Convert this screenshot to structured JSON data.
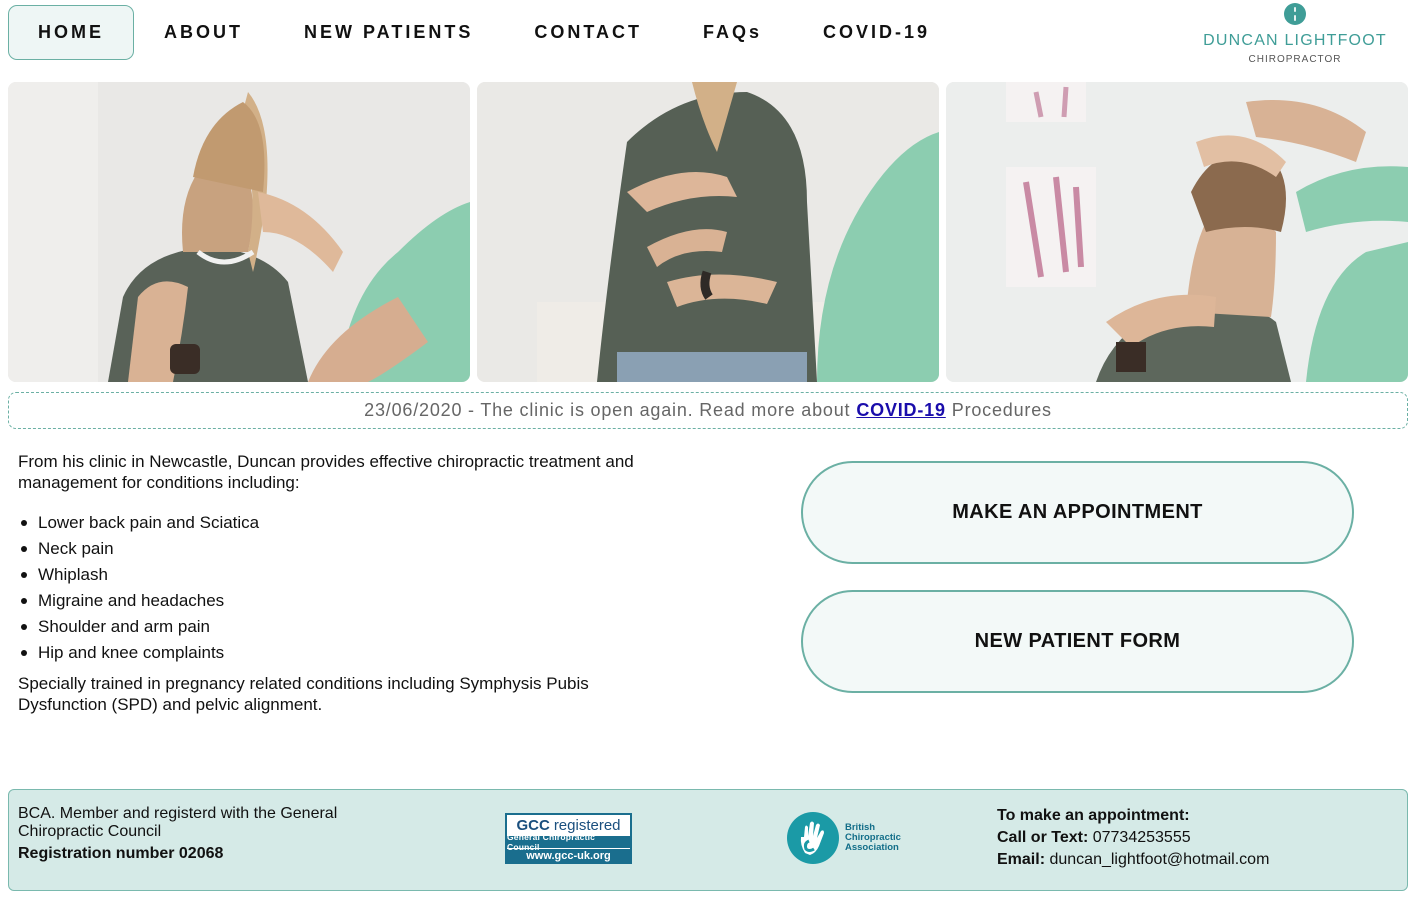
{
  "nav": {
    "items": [
      {
        "label": "HOME",
        "active": true
      },
      {
        "label": "ABOUT"
      },
      {
        "label": "NEW PATIENTS"
      },
      {
        "label": "CONTACT"
      },
      {
        "label": "FAQs"
      },
      {
        "label": "COVID-19"
      }
    ]
  },
  "logo": {
    "name": "DUNCAN LIGHTFOOT",
    "subtitle": "CHIROPRACTOR",
    "color": "#3f9d97"
  },
  "notice": {
    "prefix": "23/06/2020 - The clinic is open again. Read more about",
    "link": "COVID-19",
    "suffix": "Procedures"
  },
  "main": {
    "intro": "From his clinic in Newcastle, Duncan provides effective chiropractic treatment and management for conditions including:",
    "conditions": [
      "Lower back pain and Sciatica",
      "Neck pain",
      "Whiplash",
      "Migraine and headaches",
      "Shoulder and arm pain",
      "Hip and knee complaints"
    ],
    "pregnancy": "Specially trained in pregnancy related conditions including Symphysis Pubis Dysfunction (SPD) and pelvic alignment."
  },
  "cta": {
    "appointment": "MAKE AN APPOINTMENT",
    "new_patient": "NEW PATIENT FORM"
  },
  "footer": {
    "membership": "BCA. Member and registerd with the General Chiropractic Council",
    "registration": "Registration number 02068",
    "gcc": {
      "line1_bold": "GCC",
      "line1": "registered",
      "line2": "General Chiropractic Council",
      "line3": "www.gcc-uk.org"
    },
    "bca": {
      "line1": "British",
      "line2": "Chiropractic",
      "line3": "Association"
    },
    "contact": {
      "heading": "To make an appointment:",
      "call_label": "Call or Text:",
      "phone": "07734253555",
      "email_label": "Email:",
      "email": "duncan_lightfoot@hotmail.com"
    }
  },
  "colors": {
    "accent": "#6bb0a4",
    "footer_bg": "#d5eae7",
    "link": "#1a0dab"
  }
}
